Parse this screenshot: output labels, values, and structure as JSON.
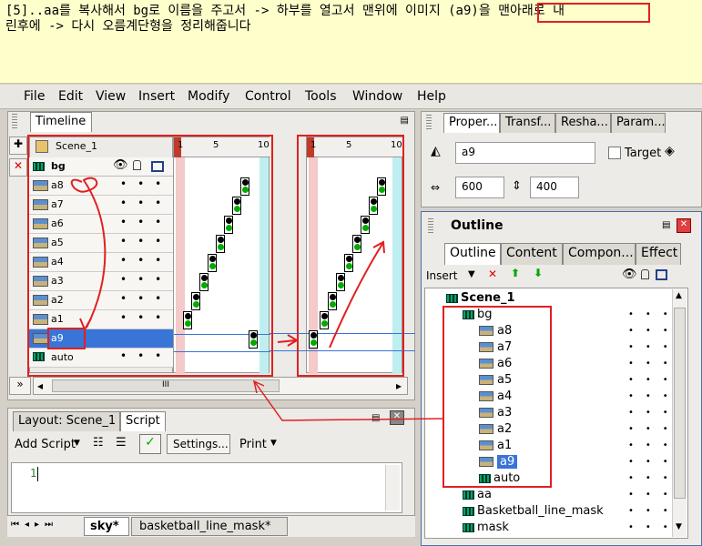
{
  "note": {
    "text": "[5]..aa를 복사해서 bg로 이름을 주고서 -> 하부를 열고서 맨위에 이미지 (a9)을 맨아래로 내\n린후에 -> 다시 오름계단형을 정리해줍니다"
  },
  "menu": [
    "File",
    "Edit",
    "View",
    "Insert",
    "Modify",
    "Control",
    "Tools",
    "Window",
    "Help"
  ],
  "timeline": {
    "tab": "Timeline",
    "scene": "Scene_1",
    "ruler_left": [
      "1",
      "5",
      "10"
    ],
    "ruler_right": [
      "1",
      "5",
      "10"
    ],
    "bg_label": "bg",
    "layers": [
      "a8",
      "a7",
      "a6",
      "a5",
      "a4",
      "a3",
      "a2",
      "a1",
      "a9",
      "auto"
    ],
    "selected_layer": "a9",
    "nav_label": "»",
    "scroll_label": "III"
  },
  "properties": {
    "tabs": [
      "Proper...",
      "Transf...",
      "Resha...",
      "Param..."
    ],
    "name_value": "a9",
    "target_label": "Target",
    "width": "600",
    "height": "400"
  },
  "outline": {
    "title": "Outline",
    "tabs": [
      "Outline",
      "Content",
      "Compon...",
      "Effect"
    ],
    "insert_label": "Insert",
    "tree": [
      {
        "label": "Scene_1",
        "level": 0,
        "bold": true
      },
      {
        "label": "bg",
        "level": 1
      },
      {
        "label": "a8",
        "level": 2
      },
      {
        "label": "a7",
        "level": 2
      },
      {
        "label": "a6",
        "level": 2
      },
      {
        "label": "a5",
        "level": 2
      },
      {
        "label": "a4",
        "level": 2
      },
      {
        "label": "a3",
        "level": 2
      },
      {
        "label": "a2",
        "level": 2
      },
      {
        "label": "a1",
        "level": 2
      },
      {
        "label": "a9",
        "level": 2,
        "selected": true
      },
      {
        "label": "auto",
        "level": 2
      },
      {
        "label": "aa",
        "level": 1
      },
      {
        "label": "Basketball_line_mask",
        "level": 1
      },
      {
        "label": "mask",
        "level": 1
      }
    ]
  },
  "script_panel": {
    "tabs": [
      "Layout: Scene_1",
      "Script"
    ],
    "add_script": "Add Script",
    "settings": "Settings...",
    "print": "Print",
    "line_number": "1"
  },
  "bottom_tabs": [
    "sky*",
    "basketball_line_mask*"
  ],
  "colors": {
    "annotation": "#e02020",
    "selection": "#3875d7",
    "note_bg": "#ffffcc"
  }
}
